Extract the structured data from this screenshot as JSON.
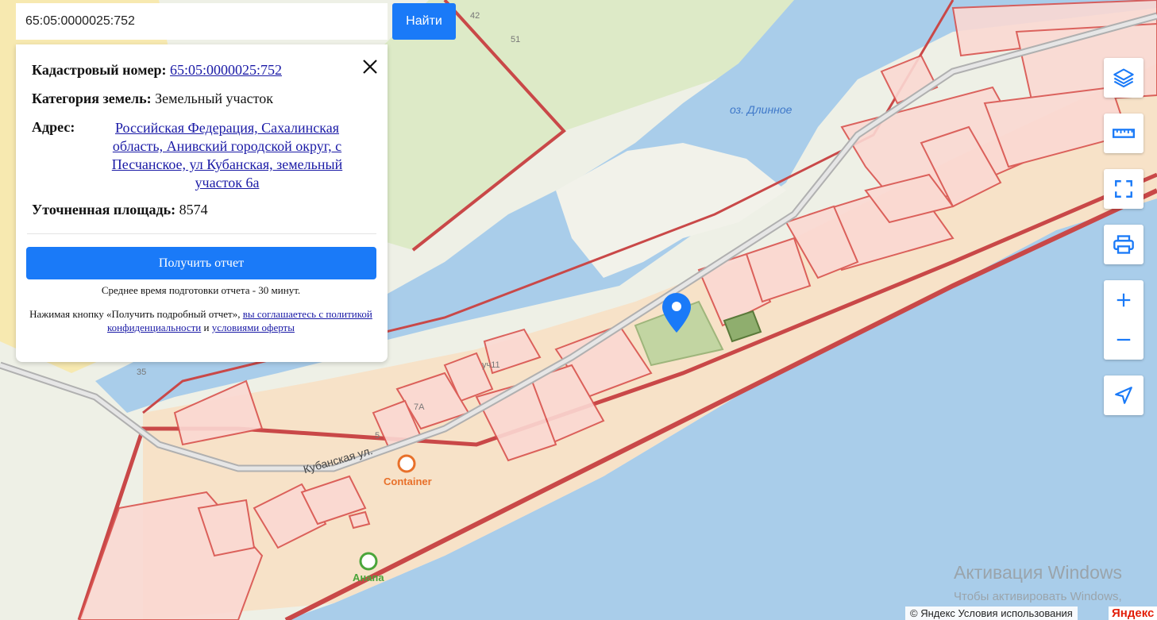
{
  "search": {
    "value": "65:05:0000025:752",
    "button_label": "Найти"
  },
  "card": {
    "cadastral_label": "Кадастровый номер:",
    "cadastral_value": "65:05:0000025:752",
    "category_label": "Категория земель:",
    "category_value": "Земельный участок",
    "address_label": "Адрес:",
    "address_value": "Российская Федерация, Сахалинская область, Анивский городской округ, с Песчанское, ул Кубанская, земельный участок 6а",
    "area_label": "Уточненная площадь:",
    "area_value": "8574",
    "report_button": "Получить отчет",
    "prep_time": "Среднее время подготовки отчета - 30 минут.",
    "agree_prefix": "Нажимая кнопку «Получить подробный отчет»,",
    "agree_link1": "вы соглашаетесь с политикой конфиденциальности",
    "agree_and": "и",
    "agree_link2": "условиями оферты"
  },
  "map_labels": {
    "lake": "оз. Длинное",
    "street": "Кубанская ул.",
    "poi_container": "Container",
    "poi_anapa": "Анапа",
    "plot_uch11": "уч11",
    "plot_7a": "7А",
    "plot_5": "5",
    "house_42": "42",
    "house_51": "51",
    "house_35": "35"
  },
  "controls": [
    "layers-icon",
    "ruler-icon",
    "fullscreen-icon",
    "print-icon",
    "zoom-in-icon",
    "zoom-out-icon",
    "geolocation-icon"
  ],
  "watermark": {
    "line1": "Активация Windows",
    "line2": "Чтобы активировать Windows,"
  },
  "copyright": "© Яндекс Условия использования",
  "brand": "Яндекс",
  "colors": {
    "accent": "#1a7af8",
    "parcel_stroke": "#d9534f",
    "parcel_fill": "#fbd9d3",
    "water": "#a9cdea",
    "highlight_parcel": "#8fae6e"
  }
}
